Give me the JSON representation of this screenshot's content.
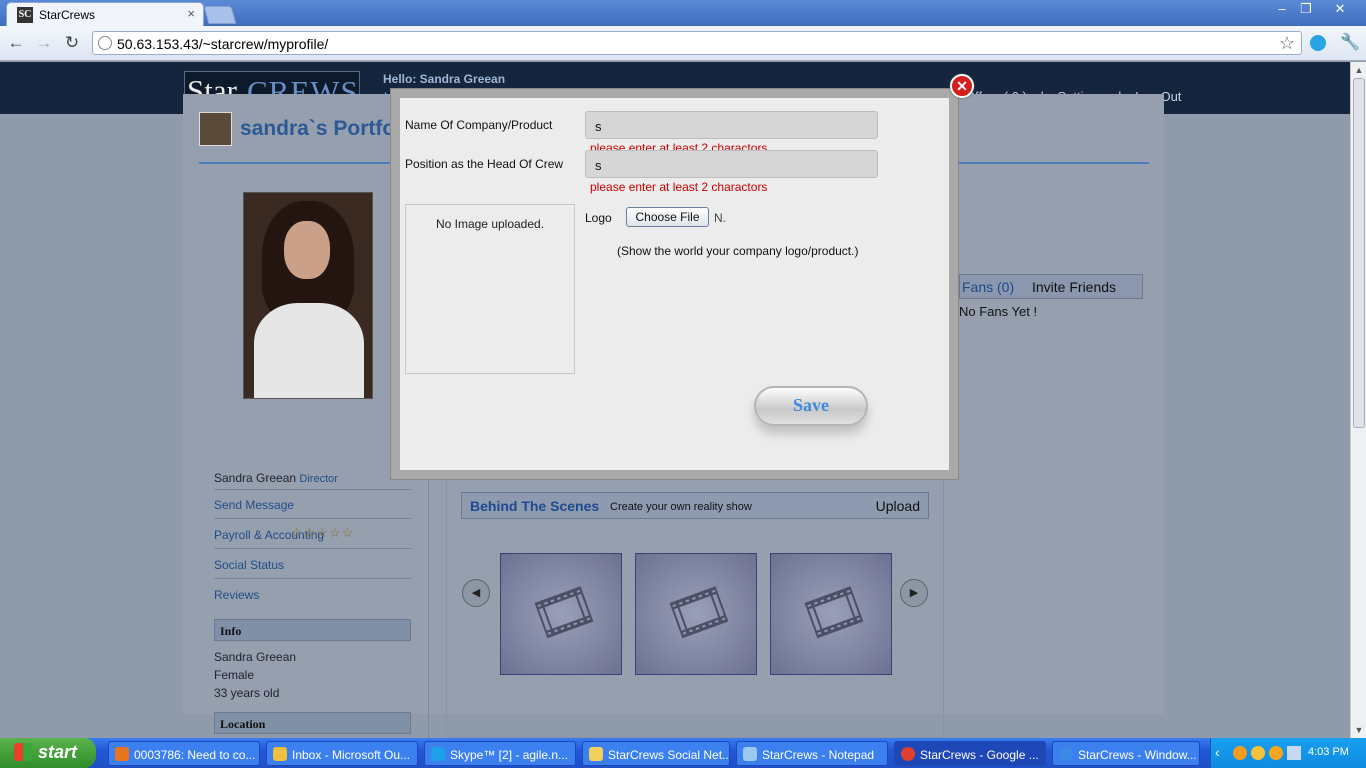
{
  "browser": {
    "tab_title": "StarCrews",
    "tab_icon_text": "SC",
    "url": "50.63.153.43/~starcrew/myprofile/"
  },
  "header": {
    "logo_star": "Star",
    "logo_crews": "CREWS",
    "hello": "Hello: Sandra Greean",
    "menu_initial": "H",
    "nav": [
      "Offers ( 0 )",
      "|",
      "Settings",
      "|",
      "Log Out"
    ]
  },
  "profile": {
    "portfolio_title": "sandra`s Portfolio",
    "name": "Sandra Greean",
    "role": "Director",
    "links": [
      "Send Message",
      "Payroll & Accounting",
      "Social Status",
      "Reviews"
    ],
    "stars": "☆☆☆☆☆",
    "info_header": "Info",
    "info": [
      "Sandra Greean",
      "Female",
      "33 years old"
    ],
    "location_header": "Location"
  },
  "fans": {
    "fans_label": "Fans (0)",
    "invite_label": "Invite Friends",
    "empty": "No Fans Yet !"
  },
  "behind_the_scenes": {
    "title": "Behind The Scenes",
    "subtitle": "Create your own reality show",
    "upload": "Upload",
    "prev_icon": "◀",
    "next_icon": "▶",
    "film_icon": "🎞"
  },
  "modal": {
    "company_label": "Name Of Company/Product",
    "company_value": "s",
    "company_error": "please enter at least 2 charactors",
    "position_label": "Position as the Head Of Crew",
    "position_value": "s",
    "position_error": "please enter at least 2 charactors",
    "no_image": "No Image uploaded.",
    "logo_label": "Logo",
    "choose_file": "Choose File",
    "file_status": "N.",
    "hint": "(Show the world your company logo/product.)",
    "save": "Save",
    "close_icon": "✕"
  },
  "taskbar": {
    "start": "start",
    "tasks": [
      {
        "label": "0003786: Need to co...",
        "color": "#e8741c"
      },
      {
        "label": "Inbox - Microsoft Ou...",
        "color": "#f0c040"
      },
      {
        "label": "Skype™ [2] - agile.n...",
        "color": "#1ea0e8"
      },
      {
        "label": "StarCrews Social Net...",
        "color": "#f2d060"
      },
      {
        "label": "StarCrews - Notepad",
        "color": "#9ec8f0"
      },
      {
        "label": "StarCrews - Google ...",
        "color": "#e04030"
      },
      {
        "label": "StarCrews - Window...",
        "color": "#3a8ae8"
      }
    ],
    "clock": "4:03 PM"
  }
}
